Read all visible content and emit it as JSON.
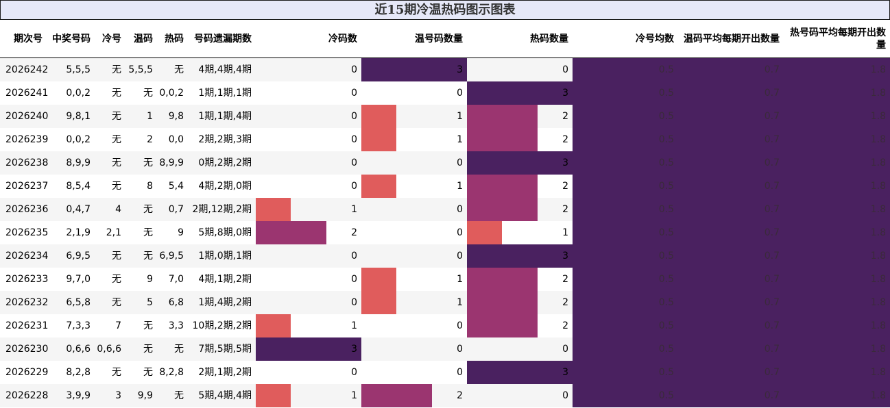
{
  "title": "近15期冷温热码图示图表",
  "columns": [
    "期次号",
    "中奖号码",
    "冷号",
    "温码",
    "热码",
    "号码遗漏期数",
    "冷码数",
    "温号码数量",
    "热码数量",
    "冷号均数",
    "温码平均每期开出数量",
    "热号码平均每期开出数量"
  ],
  "colors": {
    "level1": "#e05c5c",
    "level2": "#9b3570",
    "level3": "#4a2160",
    "avg_bg": "#4a2160",
    "title_bg": "#e6e8f8"
  },
  "rows": [
    {
      "issue": "2026242",
      "win": "5,5,5",
      "cold": "无",
      "warm": "5,5,5",
      "hot": "无",
      "miss": "4期,4期,4期",
      "cold_n": 0,
      "warm_n": 3,
      "hot_n": 0,
      "cold_avg": "0.5",
      "warm_avg": "0.7",
      "hot_avg": "1.8"
    },
    {
      "issue": "2026241",
      "win": "0,0,2",
      "cold": "无",
      "warm": "无",
      "hot": "0,0,2",
      "miss": "1期,1期,1期",
      "cold_n": 0,
      "warm_n": 0,
      "hot_n": 3,
      "cold_avg": "0.5",
      "warm_avg": "0.7",
      "hot_avg": "1.8"
    },
    {
      "issue": "2026240",
      "win": "9,8,1",
      "cold": "无",
      "warm": "1",
      "hot": "9,8",
      "miss": "1期,1期,4期",
      "cold_n": 0,
      "warm_n": 1,
      "hot_n": 2,
      "cold_avg": "0.5",
      "warm_avg": "0.7",
      "hot_avg": "1.8"
    },
    {
      "issue": "2026239",
      "win": "0,0,2",
      "cold": "无",
      "warm": "2",
      "hot": "0,0",
      "miss": "2期,2期,3期",
      "cold_n": 0,
      "warm_n": 1,
      "hot_n": 2,
      "cold_avg": "0.5",
      "warm_avg": "0.7",
      "hot_avg": "1.8"
    },
    {
      "issue": "2026238",
      "win": "8,9,9",
      "cold": "无",
      "warm": "无",
      "hot": "8,9,9",
      "miss": "0期,2期,2期",
      "cold_n": 0,
      "warm_n": 0,
      "hot_n": 3,
      "cold_avg": "0.5",
      "warm_avg": "0.7",
      "hot_avg": "1.8"
    },
    {
      "issue": "2026237",
      "win": "8,5,4",
      "cold": "无",
      "warm": "8",
      "hot": "5,4",
      "miss": "4期,2期,0期",
      "cold_n": 0,
      "warm_n": 1,
      "hot_n": 2,
      "cold_avg": "0.5",
      "warm_avg": "0.7",
      "hot_avg": "1.8"
    },
    {
      "issue": "2026236",
      "win": "0,4,7",
      "cold": "4",
      "warm": "无",
      "hot": "0,7",
      "miss": "2期,12期,2期",
      "cold_n": 1,
      "warm_n": 0,
      "hot_n": 2,
      "cold_avg": "0.5",
      "warm_avg": "0.7",
      "hot_avg": "1.8"
    },
    {
      "issue": "2026235",
      "win": "2,1,9",
      "cold": "2,1",
      "warm": "无",
      "hot": "9",
      "miss": "5期,8期,0期",
      "cold_n": 2,
      "warm_n": 0,
      "hot_n": 1,
      "cold_avg": "0.5",
      "warm_avg": "0.7",
      "hot_avg": "1.8"
    },
    {
      "issue": "2026234",
      "win": "6,9,5",
      "cold": "无",
      "warm": "无",
      "hot": "6,9,5",
      "miss": "1期,0期,1期",
      "cold_n": 0,
      "warm_n": 0,
      "hot_n": 3,
      "cold_avg": "0.5",
      "warm_avg": "0.7",
      "hot_avg": "1.8"
    },
    {
      "issue": "2026233",
      "win": "9,7,0",
      "cold": "无",
      "warm": "9",
      "hot": "7,0",
      "miss": "4期,1期,2期",
      "cold_n": 0,
      "warm_n": 1,
      "hot_n": 2,
      "cold_avg": "0.5",
      "warm_avg": "0.7",
      "hot_avg": "1.8"
    },
    {
      "issue": "2026232",
      "win": "6,5,8",
      "cold": "无",
      "warm": "5",
      "hot": "6,8",
      "miss": "1期,4期,2期",
      "cold_n": 0,
      "warm_n": 1,
      "hot_n": 2,
      "cold_avg": "0.5",
      "warm_avg": "0.7",
      "hot_avg": "1.8"
    },
    {
      "issue": "2026231",
      "win": "7,3,3",
      "cold": "7",
      "warm": "无",
      "hot": "3,3",
      "miss": "10期,2期,2期",
      "cold_n": 1,
      "warm_n": 0,
      "hot_n": 2,
      "cold_avg": "0.5",
      "warm_avg": "0.7",
      "hot_avg": "1.8"
    },
    {
      "issue": "2026230",
      "win": "0,6,6",
      "cold": "0,6,6",
      "warm": "无",
      "hot": "无",
      "miss": "7期,5期,5期",
      "cold_n": 3,
      "warm_n": 0,
      "hot_n": 0,
      "cold_avg": "0.5",
      "warm_avg": "0.7",
      "hot_avg": "1.8"
    },
    {
      "issue": "2026229",
      "win": "8,2,8",
      "cold": "无",
      "warm": "无",
      "hot": "8,2,8",
      "miss": "2期,1期,2期",
      "cold_n": 0,
      "warm_n": 0,
      "hot_n": 3,
      "cold_avg": "0.5",
      "warm_avg": "0.7",
      "hot_avg": "1.8"
    },
    {
      "issue": "2026228",
      "win": "3,9,9",
      "cold": "3",
      "warm": "9,9",
      "hot": "无",
      "miss": "5期,4期,4期",
      "cold_n": 1,
      "warm_n": 2,
      "hot_n": 0,
      "cold_avg": "0.5",
      "warm_avg": "0.7",
      "hot_avg": "1.8"
    }
  ]
}
